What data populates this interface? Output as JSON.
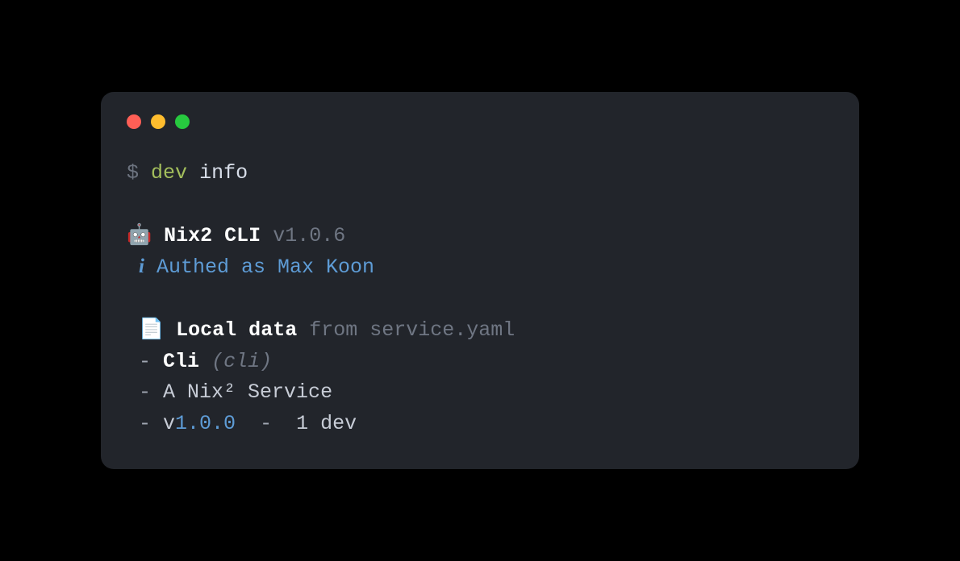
{
  "prompt": {
    "symbol": "$",
    "command": "dev",
    "arg": "info"
  },
  "header": {
    "robot_icon": "🤖",
    "title": "Nix2 CLI",
    "version": "v1.0.6"
  },
  "auth": {
    "info_icon": "i",
    "text": "Authed as Max Koon"
  },
  "local": {
    "page_icon": "📄",
    "title": "Local data",
    "source": "from service.yaml"
  },
  "items": {
    "dash1": " -",
    "name": "Cli",
    "slug": "(cli)",
    "dash2": " -",
    "desc": "A Nix² Service",
    "dash3": " -",
    "vprefix": "v",
    "version": "1.0.0",
    "sep": "  -  ",
    "devcount": "1 dev"
  }
}
